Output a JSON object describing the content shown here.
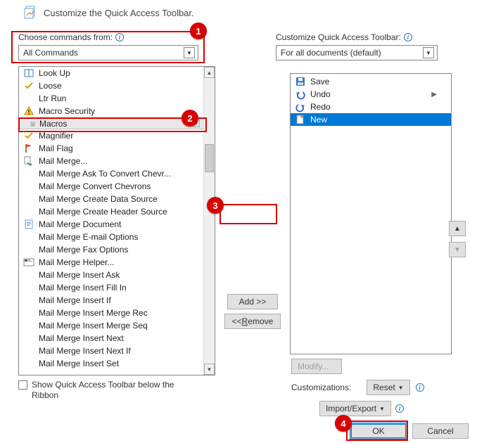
{
  "header": {
    "title": "Customize the Quick Access Toolbar."
  },
  "left": {
    "label": "Choose commands from:",
    "dropdown": "All Commands",
    "items": [
      {
        "icon": "book-icon",
        "label": "Look Up"
      },
      {
        "icon": "check-yellow-icon",
        "label": "Loose"
      },
      {
        "icon": "none",
        "label": "Ltr Run"
      },
      {
        "icon": "warn-icon",
        "label": "Macro Security"
      },
      {
        "icon": "dropdown-icon",
        "label": "Macros",
        "highlighted": true
      },
      {
        "icon": "check-yellow-icon",
        "label": "Magnifier"
      },
      {
        "icon": "flag-icon",
        "label": "Mail Flag"
      },
      {
        "icon": "mail-merge-icon",
        "label": "Mail Merge..."
      },
      {
        "icon": "none",
        "label": "Mail Merge Ask To Convert Chevr..."
      },
      {
        "icon": "none",
        "label": "Mail Merge Convert Chevrons"
      },
      {
        "icon": "none",
        "label": "Mail Merge Create Data Source"
      },
      {
        "icon": "none",
        "label": "Mail Merge Create Header Source"
      },
      {
        "icon": "doc-icon",
        "label": "Mail Merge Document"
      },
      {
        "icon": "none",
        "label": "Mail Merge E-mail Options"
      },
      {
        "icon": "none",
        "label": "Mail Merge Fax Options"
      },
      {
        "icon": "helper-icon",
        "label": "Mail Merge Helper..."
      },
      {
        "icon": "none",
        "label": "Mail Merge Insert Ask"
      },
      {
        "icon": "none",
        "label": "Mail Merge Insert Fill In"
      },
      {
        "icon": "none",
        "label": "Mail Merge Insert If"
      },
      {
        "icon": "none",
        "label": "Mail Merge Insert Merge Rec"
      },
      {
        "icon": "none",
        "label": "Mail Merge Insert Merge Seq"
      },
      {
        "icon": "none",
        "label": "Mail Merge Insert Next"
      },
      {
        "icon": "none",
        "label": "Mail Merge Insert Next If"
      },
      {
        "icon": "none",
        "label": "Mail Merge Insert Set"
      }
    ]
  },
  "right": {
    "label": "Customize Quick Access Toolbar:",
    "dropdown": "For all documents (default)",
    "items": [
      {
        "icon": "save-icon",
        "label": "Save"
      },
      {
        "icon": "undo-icon",
        "label": "Undo",
        "submenu": true
      },
      {
        "icon": "redo-icon",
        "label": "Redo"
      },
      {
        "icon": "new-icon",
        "label": "New",
        "selected": true
      }
    ]
  },
  "middle": {
    "add": "Add >>",
    "remove_prefix": "<< ",
    "remove_u": "R",
    "remove_rest": "emove"
  },
  "modify": "Modify...",
  "custom_label": "Customizations:",
  "reset": "Reset",
  "import_export": "Import/Export",
  "show_below": "Show Quick Access Toolbar below the Ribbon",
  "footer": {
    "ok": "OK",
    "cancel": "Cancel"
  },
  "callouts": {
    "c1": "1",
    "c2": "2",
    "c3": "3",
    "c4": "4"
  }
}
